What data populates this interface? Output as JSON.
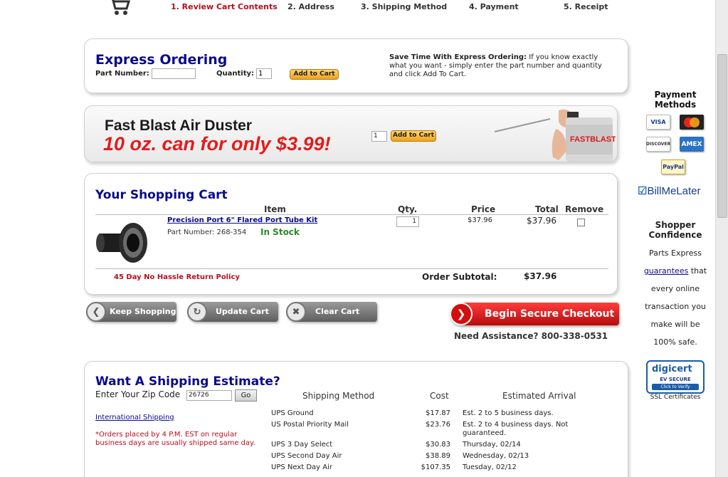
{
  "steps": [
    {
      "label": "1. Review Cart Contents",
      "active": true
    },
    {
      "label": "2. Address",
      "active": false
    },
    {
      "label": "3. Shipping Method",
      "active": false
    },
    {
      "label": "4. Payment",
      "active": false
    },
    {
      "label": "5. Receipt",
      "active": false
    }
  ],
  "express": {
    "title": "Express Ordering",
    "part_label": "Part Number:",
    "part_value": "",
    "qty_label": "Quantity:",
    "qty_value": "1",
    "add_button": "Add to Cart",
    "info_bold": "Save Time With Express Ordering:",
    "info_text": " If you know exactly what you want - simply enter the part number and quantity and click Add To Cart."
  },
  "promo": {
    "title": "Fast Blast Air Duster",
    "subtitle": "10 oz. can for only $3.99!",
    "qty_value": "1",
    "add_button": "Add to Cart",
    "can_label": "FASTBLAST"
  },
  "cart": {
    "title": "Your Shopping Cart",
    "headers": {
      "item": "Item",
      "qty": "Qty.",
      "price": "Price",
      "total": "Total",
      "remove": "Remove"
    },
    "items": [
      {
        "name": "Precision Port 6\" Flared Port Tube Kit",
        "part_number": "Part Number: 268-354",
        "stock": "In Stock",
        "qty": "1",
        "price": "$37.96",
        "total": "$37.96"
      }
    ],
    "policy": "45 Day No Hassle Return Policy",
    "subtotal_label": "Order Subtotal:",
    "subtotal_value": "$37.96"
  },
  "actions": {
    "keep_shopping": "Keep Shopping",
    "update_cart": "Update Cart",
    "clear_cart": "Clear Cart",
    "checkout": "Begin Secure Checkout",
    "assistance": "Need Assistance? 800-338-0531"
  },
  "shipping": {
    "title": "Want A Shipping Estimate?",
    "zip_label": "Enter Your Zip Code",
    "zip_value": "26726",
    "go_label": "Go",
    "international": "International Shipping",
    "note": "*Orders placed by 4 P.M. EST on regular business days are usually shipped same day.",
    "headers": {
      "method": "Shipping Method",
      "cost": "Cost",
      "arrival": "Estimated Arrival"
    },
    "rows": [
      {
        "method": "UPS Ground",
        "cost": "$17.87",
        "arrival": "Est. 2 to 5 business days."
      },
      {
        "method": "US Postal Priority Mail",
        "cost": "$23.76",
        "arrival": "Est. 2 to 4 business days. Not guaranteed."
      },
      {
        "method": "UPS 3 Day Select",
        "cost": "$30.83",
        "arrival": "Thursday, 02/14"
      },
      {
        "method": "UPS Second Day Air",
        "cost": "$38.89",
        "arrival": "Wednesday, 02/13"
      },
      {
        "method": "UPS Next Day Air",
        "cost": "$107.35",
        "arrival": "Tuesday, 02/12"
      }
    ]
  },
  "sidebar": {
    "payment_title": "Payment Methods",
    "cards": [
      "VISA",
      "MasterCard",
      "DISCOVER",
      "AMEX",
      "PayPal"
    ],
    "billmelater": "BillMeLater",
    "confidence_title": "Shopper Confidence",
    "confidence_pre": "Parts Express",
    "confidence_link": "guarantees",
    "confidence_post": " that every online transaction you make will be 100% safe.",
    "digicert": "digicert",
    "digicert_sub": "EV SECURE",
    "digicert_verify": "Click to Verify",
    "ssl": "SSL Certificates"
  },
  "colors": {
    "brand_blue": "#0a0a8c",
    "accent_red": "#b70f1f",
    "in_stock": "#2a8a2a"
  }
}
